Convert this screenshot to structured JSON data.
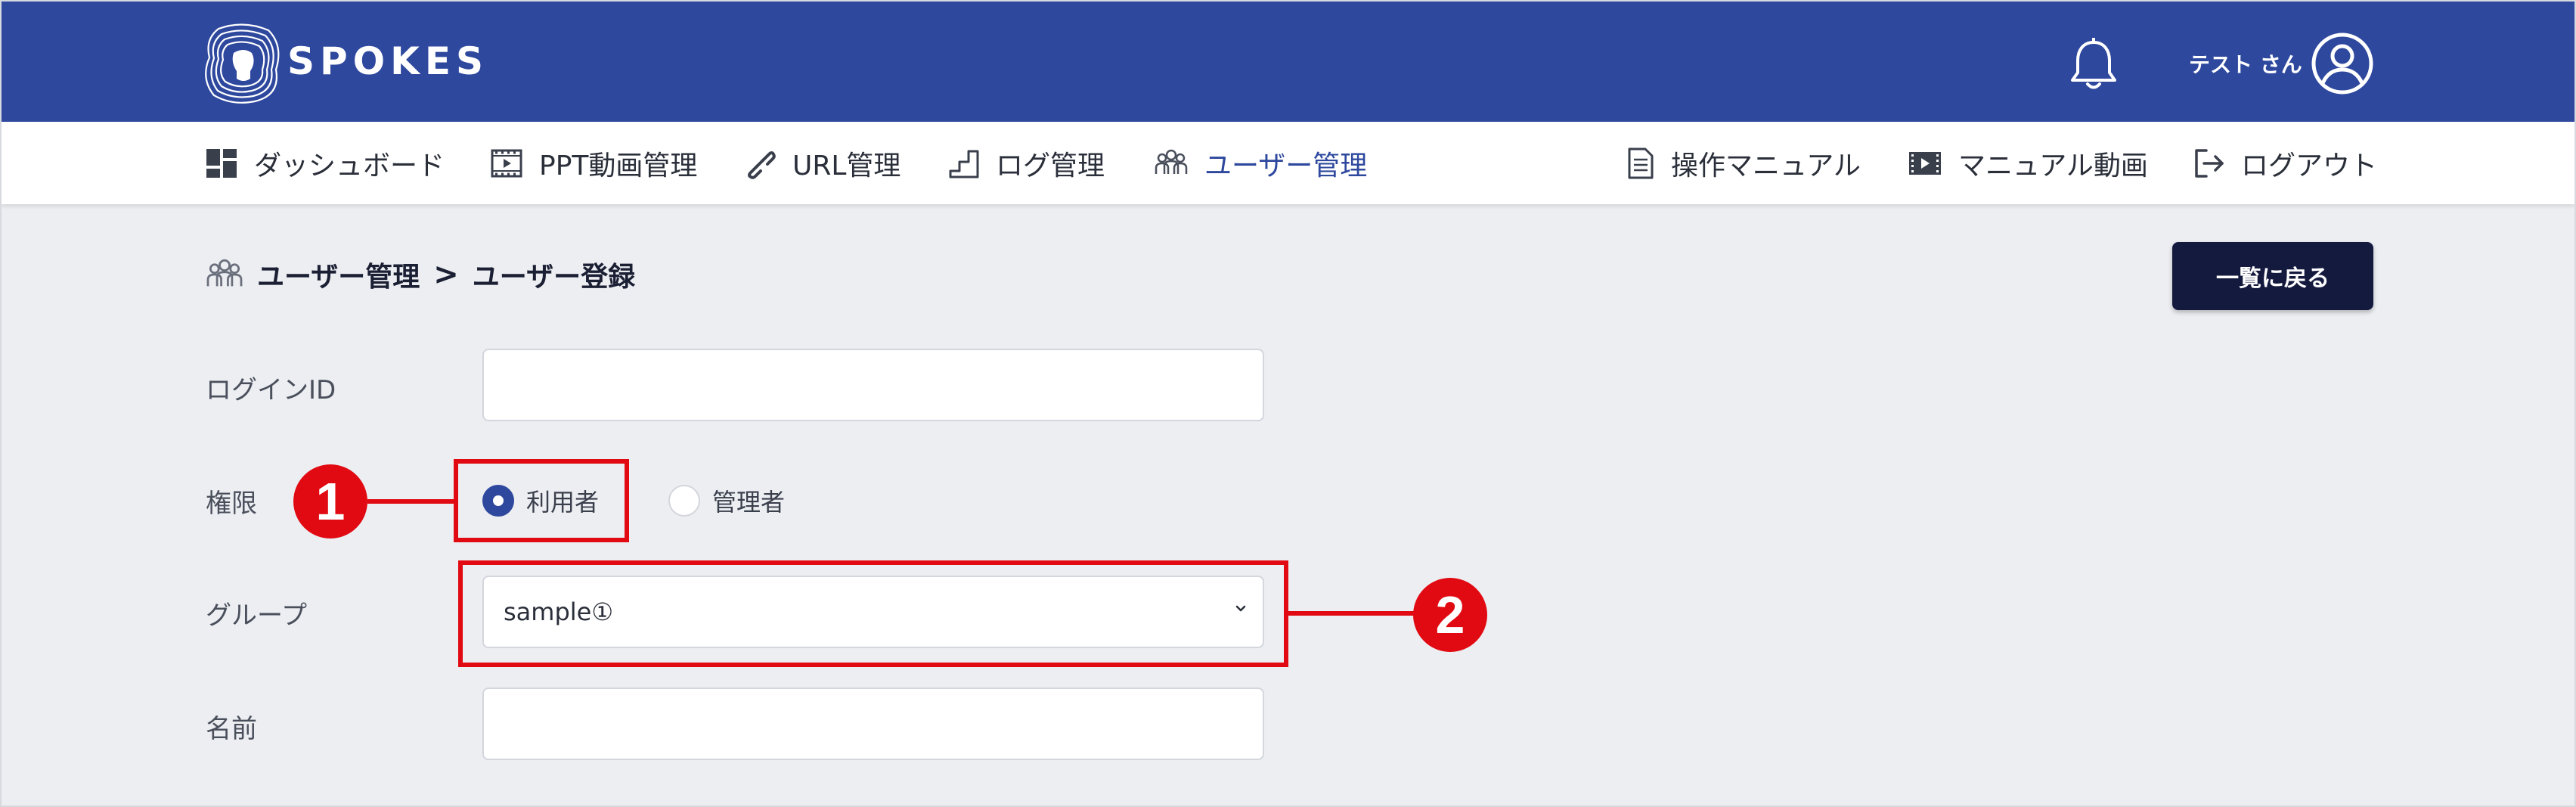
{
  "header": {
    "logo_text": "SPOKES",
    "user_name": "テスト さん",
    "brand_color": "#2e489e"
  },
  "nav": {
    "left": [
      {
        "label": "ダッシュボード",
        "icon": "dashboard-icon"
      },
      {
        "label": "PPT動画管理",
        "icon": "film-icon"
      },
      {
        "label": "URL管理",
        "icon": "link-icon"
      },
      {
        "label": "ログ管理",
        "icon": "stairs-chart-icon"
      },
      {
        "label": "ユーザー管理",
        "icon": "users-icon",
        "active": true
      }
    ],
    "right": [
      {
        "label": "操作マニュアル",
        "icon": "document-icon"
      },
      {
        "label": "マニュアル動画",
        "icon": "video-icon"
      },
      {
        "label": "ログアウト",
        "icon": "logout-icon"
      }
    ]
  },
  "breadcrumb": {
    "parent": "ユーザー管理",
    "separator": ">",
    "current": "ユーザー登録"
  },
  "back_button": "一覧に戻る",
  "form": {
    "login_id_label": "ログインID",
    "login_id_value": "",
    "role_label": "権限",
    "role_options": [
      {
        "label": "利用者",
        "checked": true
      },
      {
        "label": "管理者",
        "checked": false
      }
    ],
    "group_label": "グループ",
    "group_selected": "sample①",
    "name_label": "名前",
    "name_value": ""
  },
  "annotations": {
    "badge_1": "1",
    "badge_2": "2",
    "callout_color": "#e10a12"
  }
}
